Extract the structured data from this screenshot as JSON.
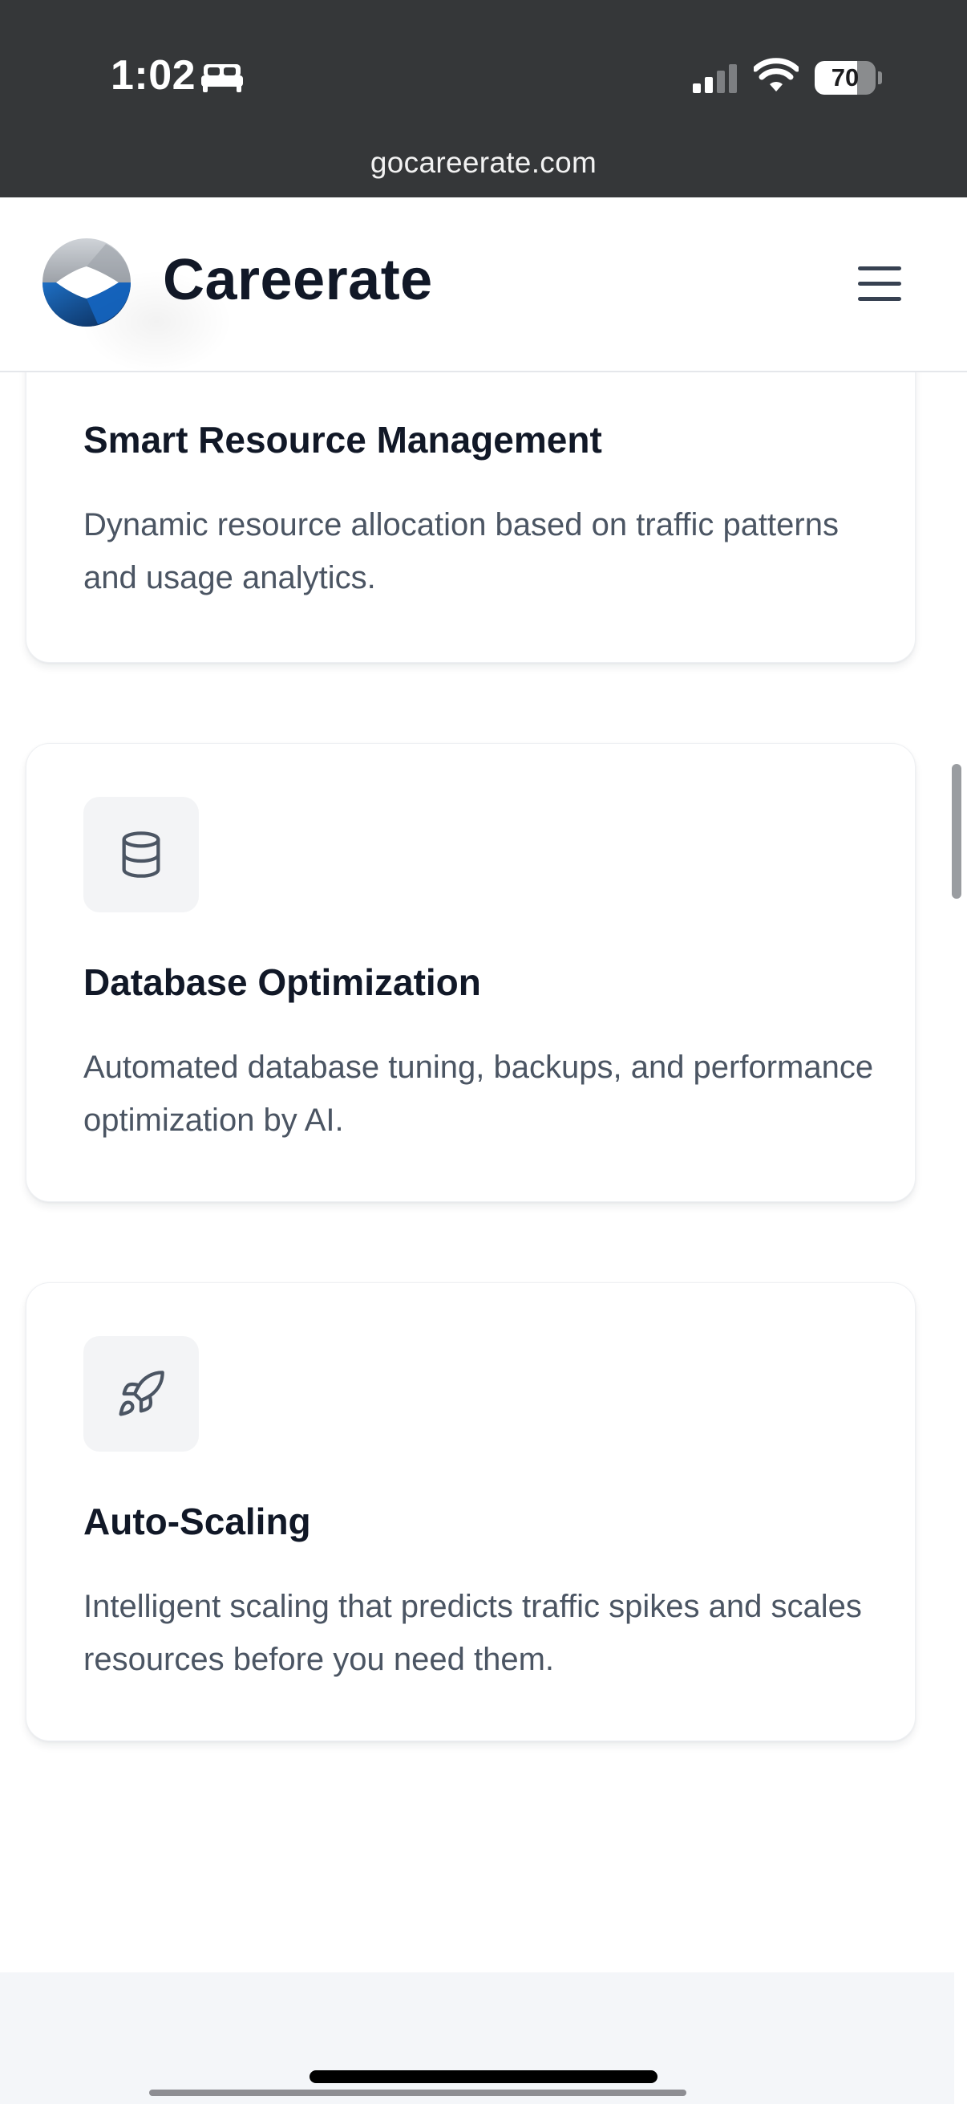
{
  "status_bar": {
    "time": "1:02",
    "sleep_icon": "bed-icon",
    "signal_icon": "cellular-signal-icon",
    "wifi_icon": "wifi-icon",
    "battery_icon": "battery-icon",
    "battery_level": "70",
    "battery_fraction": 0.7
  },
  "browser": {
    "url": "gocareerate.com"
  },
  "header": {
    "logo_icon": "careerate-logo-icon",
    "brand_name": "Careerate",
    "menu_icon": "hamburger-menu-icon"
  },
  "features": [
    {
      "title": "Smart Resource Management",
      "description": "Dynamic resource allocation based on traffic patterns and usage analytics."
    },
    {
      "icon": "database-icon",
      "title": "Database Optimization",
      "description": "Automated database tuning, backups, and performance optimization by AI."
    },
    {
      "icon": "rocket-icon",
      "title": "Auto-Scaling",
      "description": "Intelligent scaling that predicts traffic spikes and scales resources before you need them."
    }
  ],
  "colors": {
    "status_bar_bg": "#353739",
    "heading_text": "#111827",
    "body_text": "#4b5563",
    "icon_tile_bg": "#f3f4f6",
    "footer_bg": "#f4f6f9",
    "logo_blue": "#1565c0",
    "logo_navy": "#0d2b52"
  }
}
